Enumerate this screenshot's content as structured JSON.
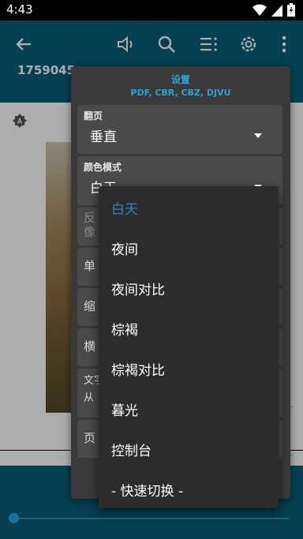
{
  "status": {
    "time": "4:43"
  },
  "header": {
    "doc_title": "1759045"
  },
  "settings": {
    "title": "设置",
    "formats": "PDF, CBR, CBZ, DJVU",
    "page_turn": {
      "label": "翻页",
      "value": "垂直"
    },
    "color_mode": {
      "label": "颜色模式",
      "value": "白天"
    },
    "partial_rows": [
      {
        "text": "反\n像"
      },
      {
        "text": "单"
      },
      {
        "text": "缩"
      },
      {
        "text": "横"
      },
      {
        "text": "文字\n从"
      },
      {
        "text": "页"
      }
    ]
  },
  "dropdown": {
    "options": [
      {
        "label": "白天",
        "selected": true
      },
      {
        "label": "夜间"
      },
      {
        "label": "夜间对比"
      },
      {
        "label": "棕褐"
      },
      {
        "label": "棕褐对比"
      },
      {
        "label": "暮光"
      },
      {
        "label": "控制台"
      },
      {
        "label": "- 快速切换 -"
      }
    ]
  },
  "colors": {
    "appbar": "#075f7a",
    "accent": "#2aa4d5",
    "selected_option": "#2a87b8"
  }
}
